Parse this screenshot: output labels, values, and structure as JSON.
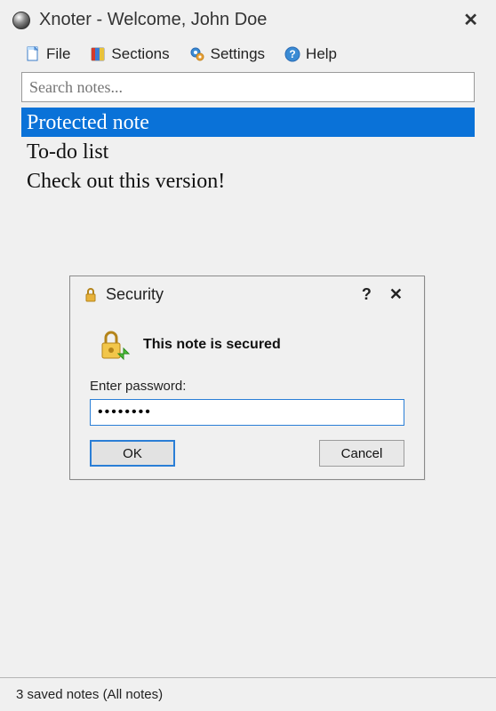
{
  "window": {
    "title": "Xnoter - Welcome, John Doe"
  },
  "menu": {
    "file": "File",
    "sections": "Sections",
    "settings": "Settings",
    "help": "Help"
  },
  "search": {
    "placeholder": "Search notes..."
  },
  "notes": [
    {
      "title": "Protected note",
      "selected": true
    },
    {
      "title": "To-do list",
      "selected": false
    },
    {
      "title": "Check out this version!",
      "selected": false
    }
  ],
  "dialog": {
    "title": "Security",
    "message": "This note is secured",
    "password_label": "Enter password:",
    "password_value": "••••••••",
    "ok_label": "OK",
    "cancel_label": "Cancel"
  },
  "status": {
    "text": "3 saved notes (All notes)"
  },
  "icons": {
    "app": "globe-icon",
    "file": "file-icon",
    "sections": "sections-icon",
    "settings": "gear-icon",
    "help": "help-icon",
    "lock_small": "lock-icon",
    "lock_large": "lock-large-icon"
  },
  "colors": {
    "selection": "#0a72d8",
    "dialog_border": "#8a8a8a",
    "primary_border": "#2a7ed6",
    "background": "#f0f0f0"
  }
}
